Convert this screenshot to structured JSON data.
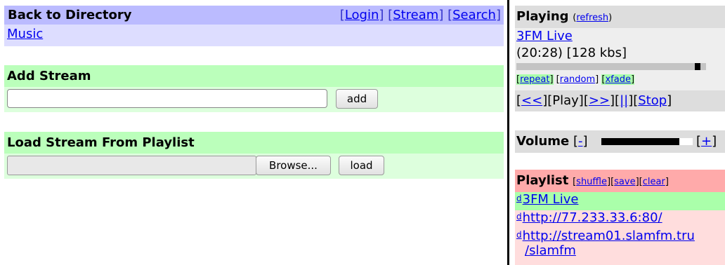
{
  "header": {
    "title": "Back to Directory",
    "links": [
      {
        "label": "Login"
      },
      {
        "label": "Stream"
      },
      {
        "label": "Search"
      }
    ],
    "breadcrumb": "Music"
  },
  "add_stream": {
    "title": "Add Stream",
    "input_value": "",
    "add_label": "add"
  },
  "load_stream": {
    "title": "Load Stream From Playlist",
    "browse_label": "Browse...",
    "load_label": "load"
  },
  "playing": {
    "title": "Playing",
    "refresh_label": "refresh",
    "current": "3FM Live",
    "info": "(20:28) [128 kbs]",
    "progress": 0.97,
    "options": [
      "repeat",
      "random",
      "xfade"
    ],
    "controls": {
      "prev": "<<",
      "play": "Play",
      "next": ">>",
      "pause": "||",
      "stop": "Stop"
    }
  },
  "volume": {
    "label": "Volume",
    "minus": "-",
    "plus": "+",
    "level": 0.85
  },
  "playlist": {
    "title": "Playlist",
    "actions": [
      "shuffle",
      "save",
      "clear"
    ],
    "items": [
      {
        "delete": "d",
        "label": "3FM Live"
      },
      {
        "delete": "d",
        "label": "http://77.233.33.6:80/"
      },
      {
        "delete": "d",
        "label": "http://stream01.slamfm.tru",
        "label2": "/slamfm"
      }
    ]
  },
  "colors": {
    "directory_header": "#bbbbff",
    "directory_body": "#ddddff",
    "section_header": "#bbffbb",
    "section_body": "#ddffdd",
    "playing_header": "#dddddd",
    "playing_body": "#eeeeee",
    "playlist_header": "#ffaaaa",
    "playlist_current": "#aaffaa",
    "playlist_row": "#ffdddd"
  }
}
